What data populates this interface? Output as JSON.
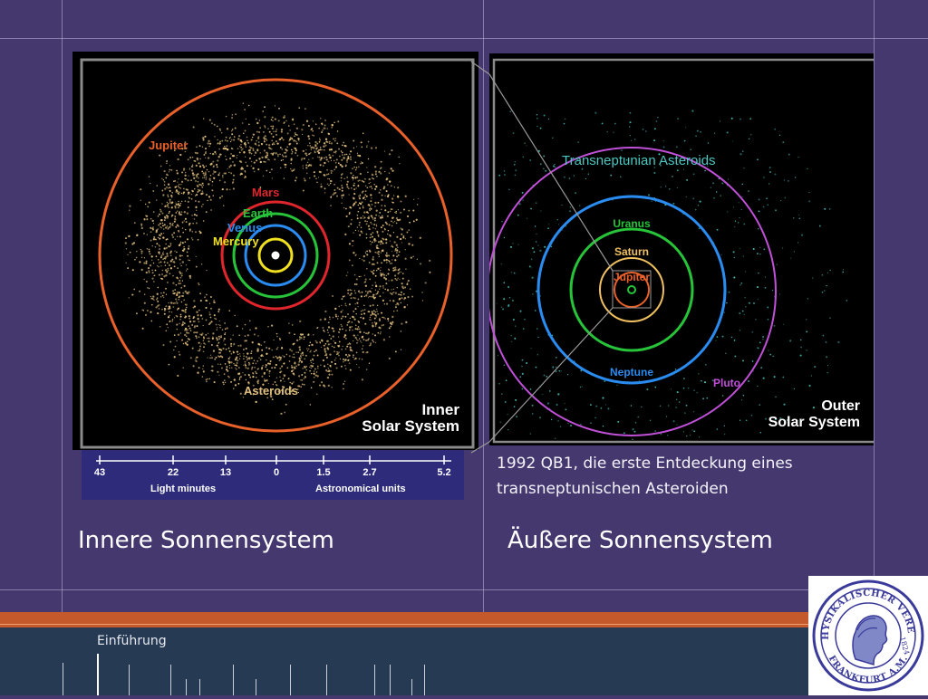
{
  "left_panel": {
    "labels": {
      "jupiter": "Jupiter",
      "mars": "Mars",
      "earth": "Earth",
      "venus": "Venus",
      "mercury": "Mercury",
      "asteroids": "Asteroids"
    },
    "title_line1": "Inner",
    "title_line2": "Solar System"
  },
  "scale_bar": {
    "ticks": [
      "43",
      "22",
      "13",
      "0",
      "1.5",
      "2.7",
      "5.2"
    ],
    "label_left": "Light minutes",
    "label_right": "Astronomical units"
  },
  "right_panel": {
    "heading": "Transneptunian Asteroids",
    "labels": {
      "uranus": "Uranus",
      "saturn": "Saturn",
      "jupiter": "Jupiter",
      "neptune": "Neptune",
      "pluto": "Pluto"
    },
    "title_line1": "Outer",
    "title_line2": "Solar System"
  },
  "caption": {
    "line1": "1992 QB1, die erste Entdeckung eines",
    "line2": "transneptunischen Asteroiden"
  },
  "subtitles": {
    "left": "Innere Sonnensystem",
    "right": "Äußere Sonnensystem"
  },
  "footer": {
    "label": "Einführung"
  },
  "logo": {
    "text_top": "PHYSIKALISCHER VEREIN",
    "text_bottom": "FRANKFURT A.M.",
    "year": "1824"
  },
  "colors": {
    "background": "#45386e",
    "jupiter_orbit": "#e8602a",
    "mars_orbit": "#e0262c",
    "earth_orbit": "#27c43a",
    "venus_orbit": "#2a8cf0",
    "mercury_orbit": "#f0e020",
    "asteroids": "#e0bf7e",
    "pluto_orbit": "#c050d8",
    "transneptunian": "#49c7c0",
    "footer": "#263a54",
    "accent_band": "#c45a2b"
  }
}
